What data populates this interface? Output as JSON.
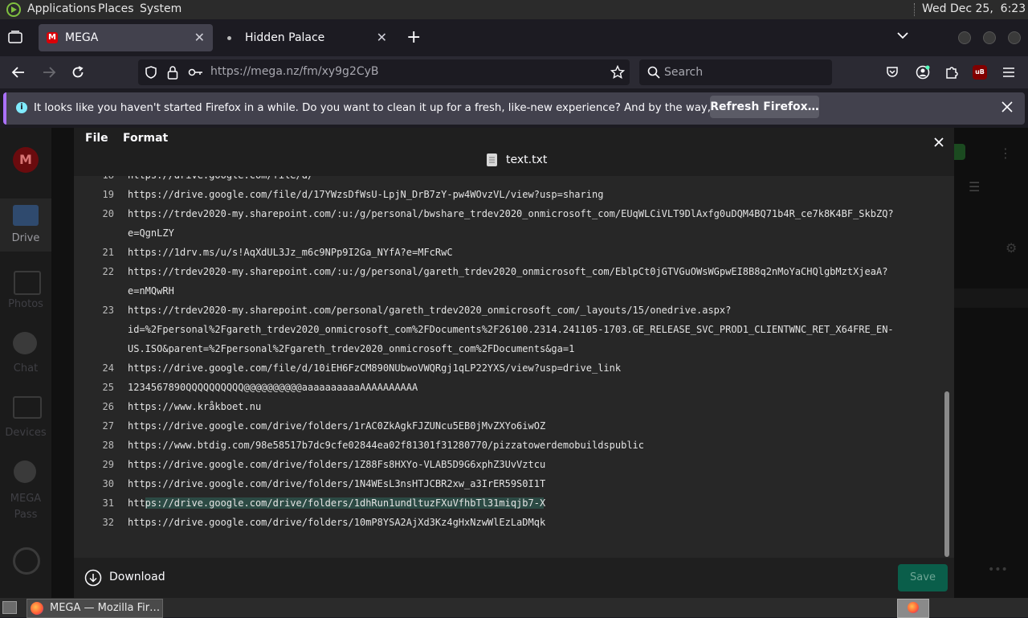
{
  "system": {
    "menus": [
      "Applications",
      "Places",
      "System"
    ],
    "clock": "Wed Dec 25,  6:23 PM"
  },
  "tabs": [
    {
      "title": "MEGA",
      "active": true
    },
    {
      "title": "Hidden Palace",
      "active": false
    }
  ],
  "nav": {
    "url_domain": "https://mega.nz",
    "url_path": "/fm/xy9g2CyB",
    "search_placeholder": "Search"
  },
  "notification": {
    "message": "It looks like you haven't started Firefox in a while. Do you want to clean it up for a fresh, like-new experience? And by the way, welcome back!",
    "button": "Refresh Firefox…"
  },
  "mega_sidebar": {
    "items": [
      "Drive",
      "Photos",
      "Chat",
      "Devices",
      "MEGA Pass"
    ]
  },
  "editor": {
    "menu": [
      "File",
      "Format"
    ],
    "filename": "text.txt",
    "lines": [
      {
        "num": "19",
        "text": "https://drive.google.com/file/d/17YWzsDfWsU-LpjN_DrB7zY-pw4WOvzVL/view?usp=sharing"
      },
      {
        "num": "20",
        "text": "https://trdev2020-my.sharepoint.com/:u:/g/personal/bwshare_trdev2020_onmicrosoft_com/EUqWLCiVLT9DlAxfg0uDQM4BQ71b4R_ce7k8K4BF_SkbZQ?"
      },
      {
        "num": "",
        "text": "e=QgnLZY"
      },
      {
        "num": "21",
        "text": "https://1drv.ms/u/s!AqXdUL3Jz_m6c9NPp9I2Ga_NYfA?e=MFcRwC"
      },
      {
        "num": "22",
        "text": "https://trdev2020-my.sharepoint.com/:u:/g/personal/gareth_trdev2020_onmicrosoft_com/EblpCt0jGTVGuOWsWGpwEI8B8q2nMoYaCHQlgbMztXjeaA?"
      },
      {
        "num": "",
        "text": "e=nMQwRH"
      },
      {
        "num": "23",
        "text": "https://trdev2020-my.sharepoint.com/personal/gareth_trdev2020_onmicrosoft_com/_layouts/15/onedrive.aspx?"
      },
      {
        "num": "",
        "text": "id=%2Fpersonal%2Fgareth_trdev2020_onmicrosoft_com%2FDocuments%2F26100.2314.241105-1703.GE_RELEASE_SVC_PROD1_CLIENTWNC_RET_X64FRE_EN-"
      },
      {
        "num": "",
        "text": "US.ISO&parent=%2Fpersonal%2Fgareth_trdev2020_onmicrosoft_com%2FDocuments&ga=1"
      },
      {
        "num": "24",
        "text": "https://drive.google.com/file/d/10iEH6FzCM890NUbwoVWQRgj1qLP22YXS/view?usp=drive_link"
      },
      {
        "num": "25",
        "text": "1234567890QQQQQQQQQQ@@@@@@@@@@aaaaaaaaaaAAAAAAAAAA"
      },
      {
        "num": "26",
        "text": "https://www.kråkboet.nu"
      },
      {
        "num": "27",
        "text": "https://drive.google.com/drive/folders/1rAC0ZkAgkFJZUNcu5EB0jMvZXYo6iwOZ"
      },
      {
        "num": "28",
        "text": "https://www.btdig.com/98e58517b7dc9cfe02844ea02f81301f31280770/pizzatowerdemobuildspublic"
      },
      {
        "num": "29",
        "text": "https://drive.google.com/drive/folders/1Z88Fs8HXYo-VLAB5D9G6xphZ3UvVztcu"
      },
      {
        "num": "30",
        "text": "https://drive.google.com/drive/folders/1N4WEsL3nsHTJCBR2xw_a3IrER59S0I1T"
      },
      {
        "num": "31",
        "text": "https://drive.google.com/drive/folders/1dhRun1undltuzFXuVfhbTl31miqjb7-X"
      },
      {
        "num": "32",
        "text": "https://drive.google.com/drive/folders/10mP8YSA2AjXd3Kz4gHxNzwWlEzLaDMqk"
      }
    ],
    "download_label": "Download",
    "save_label": "Save"
  },
  "taskbar": {
    "window_title": "MEGA — Mozilla Fir…"
  },
  "colors": {
    "mega_red": "#d90007",
    "selection": "#2c4a44",
    "save_green": "#0a5e4a",
    "ublock_red": "#800000"
  }
}
